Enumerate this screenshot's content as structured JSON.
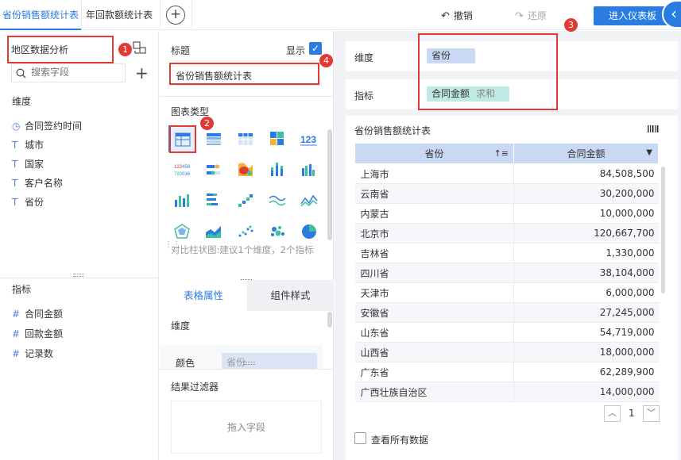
{
  "tabs": [
    {
      "label": "省份销售额统计表"
    },
    {
      "label": "年回款额统计表"
    }
  ],
  "toolbar": {
    "undo_label": "撤销",
    "redo_label": "还原",
    "enter_label": "进入仪表板"
  },
  "left": {
    "analysis_title": "地区数据分析",
    "search_placeholder": "搜索字段",
    "dimension_header": "维度",
    "dimensions": [
      {
        "icon": "clock-icon",
        "glyph": "◷",
        "label": "合同签约时间"
      },
      {
        "icon": "text-type-icon",
        "glyph": "T",
        "label": "城市"
      },
      {
        "icon": "text-type-icon",
        "glyph": "T",
        "label": "国家"
      },
      {
        "icon": "text-type-icon",
        "glyph": "T",
        "label": "客户名称"
      },
      {
        "icon": "text-type-icon",
        "glyph": "T",
        "label": "省份"
      }
    ],
    "measure_header": "指标",
    "measures": [
      {
        "icon": "number-type-icon",
        "glyph": "#",
        "label": "合同金额"
      },
      {
        "icon": "number-type-icon",
        "glyph": "#",
        "label": "回款金额"
      },
      {
        "icon": "count-type-icon",
        "glyph": "#",
        "label": "记录数"
      }
    ]
  },
  "mid": {
    "title_label": "标题",
    "show_label": "显示",
    "show_checked": true,
    "title_value": "省份销售额统计表",
    "chart_type_label": "图表类型",
    "chart_type_hint": "对比柱状图:建议1个维度，2个指标",
    "tab_table_props": "表格属性",
    "tab_component_style": "组件样式",
    "dimension_label": "维度",
    "color_label": "颜色",
    "color_field": "省份",
    "filter_header": "结果过滤器",
    "filter_drop_hint": "拖入字段"
  },
  "right": {
    "dimension_label": "维度",
    "dimension_value": "省份",
    "measure_label": "指标",
    "measure_value": "合同金额",
    "measure_agg": "求和",
    "table_title": "省份销售额统计表",
    "col_province": "省份",
    "col_amount": "合同金额",
    "rows": [
      {
        "province": "上海市",
        "amount": "84,508,500"
      },
      {
        "province": "云南省",
        "amount": "30,200,000"
      },
      {
        "province": "内蒙古",
        "amount": "10,000,000"
      },
      {
        "province": "北京市",
        "amount": "120,667,700"
      },
      {
        "province": "吉林省",
        "amount": "1,330,000"
      },
      {
        "province": "四川省",
        "amount": "38,104,000"
      },
      {
        "province": "天津市",
        "amount": "6,000,000"
      },
      {
        "province": "安徽省",
        "amount": "27,245,000"
      },
      {
        "province": "山东省",
        "amount": "54,719,000"
      },
      {
        "province": "山西省",
        "amount": "18,000,000"
      },
      {
        "province": "广东省",
        "amount": "62,289,900"
      },
      {
        "province": "广西壮族自治区",
        "amount": "14,000,000"
      }
    ],
    "page_number": "1",
    "view_all_label": "查看所有数据"
  },
  "callouts": [
    "1",
    "2",
    "3",
    "4"
  ],
  "colors": {
    "accent": "#2a7ce0",
    "callout": "#e03a35",
    "dim_pill": "#c9d9f3",
    "measure_pill": "#bfe9e2",
    "header_bg": "#c9d9f3"
  }
}
